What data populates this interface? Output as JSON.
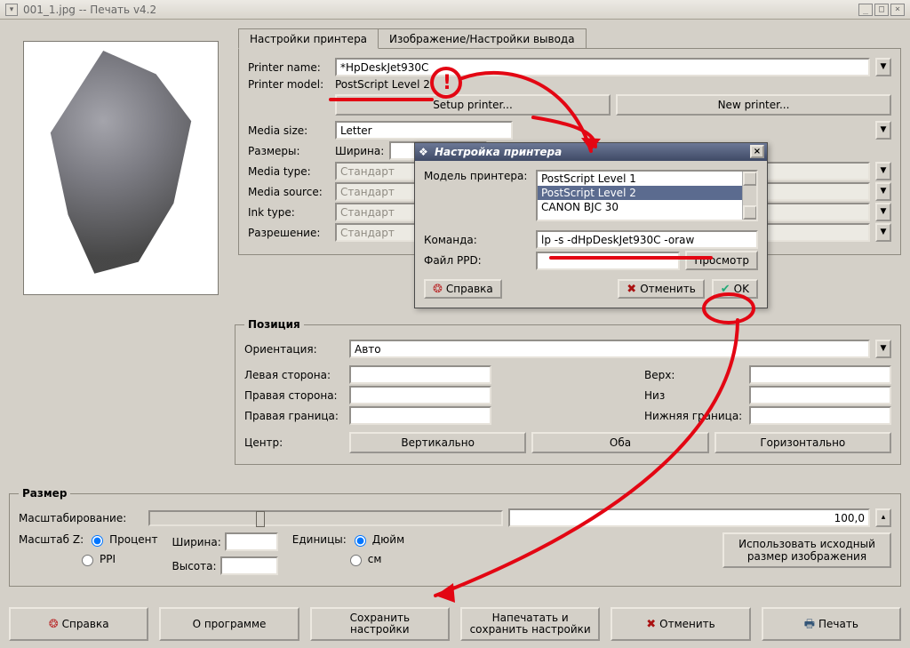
{
  "window": {
    "title": "001_1.jpg -- Печать v4.2"
  },
  "tabs": {
    "printer": "Настройки принтера",
    "output": "Изображение/Настройки вывода"
  },
  "printer": {
    "name_label": "Printer name:",
    "name_value": "*HpDeskJet930C",
    "model_label": "Printer model:",
    "model_value": "PostScript Level 2",
    "setup_button": "Setup printer...",
    "new_button": "New printer...",
    "media_size_label": "Media size:",
    "media_size_value": "Letter",
    "dims_label": "Размеры:",
    "width_label": "Ширина:",
    "media_type_label": "Media type:",
    "media_type_value": "Стандарт",
    "media_source_label": "Media source:",
    "media_source_value": "Стандарт",
    "ink_type_label": "Ink type:",
    "ink_type_value": "Стандарт",
    "resolution_label": "Разрешение:",
    "resolution_value": "Стандарт"
  },
  "position": {
    "legend": "Позиция",
    "orient_label": "Ориентация:",
    "orient_value": "Авто",
    "left_label": "Левая сторона:",
    "right_label": "Правая сторона:",
    "rborder_label": "Правая граница:",
    "top_label": "Верх:",
    "bottom_label": "Низ",
    "bborder_label": "Нижняя граница:",
    "center_label": "Центр:",
    "center_vert": "Вертикально",
    "center_both": "Оба",
    "center_horz": "Горизонтально"
  },
  "size": {
    "legend": "Размер",
    "scale_label": "Масштабирование:",
    "scale_value": "100,0",
    "scalez_label": "Масштаб Z:",
    "opt_percent": "Процент",
    "opt_ppi": "PPI",
    "width_label": "Ширина:",
    "height_label": "Высота:",
    "units_label": "Единицы:",
    "opt_inch": "Дюйм",
    "opt_cm": "см",
    "orig_size_btn": "Использовать исходный размер изображения"
  },
  "buttons": {
    "help": "Справка",
    "about": "О программе",
    "save": "Сохранить\nнастройки",
    "print_and_save": "Напечатать и\nсохранить настройки",
    "cancel": "Отменить",
    "print": "Печать"
  },
  "subdlg": {
    "title": "Настройка принтера",
    "model_label": "Модель принтера:",
    "model_options": [
      "PostScript Level 1",
      "PostScript Level 2",
      "CANON BJC 30"
    ],
    "command_label": "Команда:",
    "command_value": "lp -s -dHpDeskJet930C -oraw",
    "ppd_label": "Файл PPD:",
    "browse": "Просмотр",
    "help": "Справка",
    "cancel": "Отменить",
    "ok": "OK"
  }
}
